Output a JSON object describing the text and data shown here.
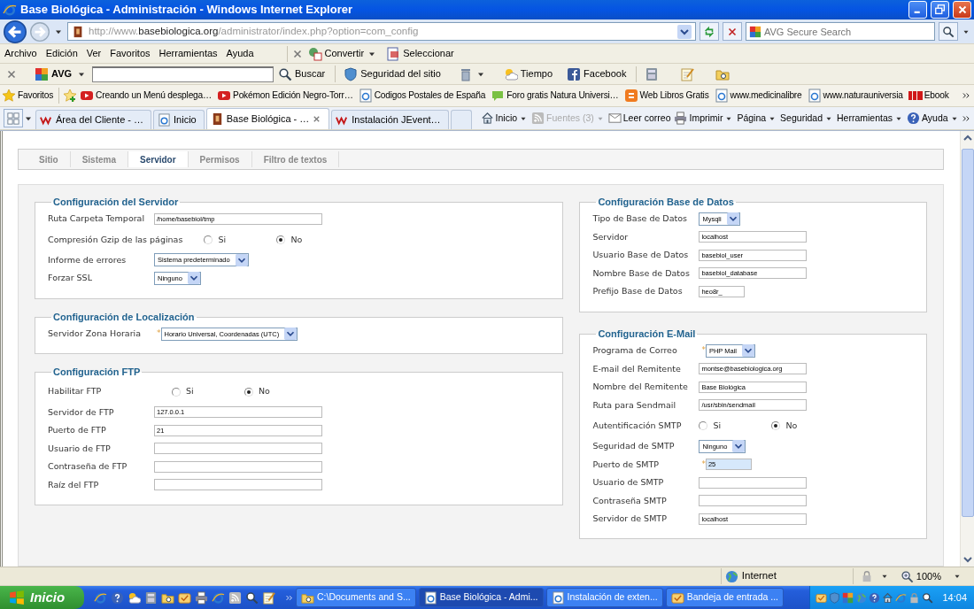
{
  "window": {
    "title": "Base Biológica - Administración - Windows Internet Explorer"
  },
  "address_bar": {
    "url_prefix": "http://www.",
    "url_domain": "basebiologica.org",
    "url_path": "/administrator/index.php?option=com_config"
  },
  "search": {
    "placeholder": "AVG Secure Search"
  },
  "menu": [
    "Archivo",
    "Edición",
    "Ver",
    "Favoritos",
    "Herramientas",
    "Ayuda"
  ],
  "menu_tools": [
    {
      "label": "Convertir",
      "kind": "convert",
      "dropdown": true
    },
    {
      "label": "Seleccionar",
      "kind": "select",
      "dropdown": false
    }
  ],
  "avg_toolbar": {
    "brand": "AVG",
    "items": [
      {
        "label": "Buscar",
        "kind": "search",
        "dropdown": false,
        "separator_before": false
      },
      {
        "label": "Seguridad del sitio",
        "kind": "shield",
        "dropdown": false,
        "separator_before": true
      },
      {
        "kind": "trash",
        "dropdown": true,
        "separator_before": false
      },
      {
        "label": "Tiempo",
        "kind": "weather",
        "dropdown": false,
        "separator_before": false
      },
      {
        "label": "Facebook",
        "kind": "facebook",
        "dropdown": false,
        "separator_before": false
      },
      {
        "kind": "calculator",
        "dropdown": false,
        "separator_before": true
      },
      {
        "kind": "notepad",
        "dropdown": false,
        "separator_before": false
      },
      {
        "kind": "folder",
        "dropdown": false,
        "separator_before": false
      }
    ]
  },
  "favorites": {
    "label": "Favoritos",
    "links": [
      {
        "label": "Creando un Menú desplega…",
        "kind": "video"
      },
      {
        "label": "Pokémon Edición Negro-Torr…",
        "kind": "video"
      },
      {
        "label": "Codigos Postales de España",
        "kind": "page"
      },
      {
        "label": "Foro gratis  Natura Universi…",
        "kind": "chat"
      },
      {
        "label": "Web Libros Gratis",
        "kind": "blog"
      },
      {
        "label": "www.medicinalibre",
        "kind": "page"
      },
      {
        "label": "www.naturauniversia",
        "kind": "page"
      },
      {
        "label": "Ebook",
        "kind": "jam"
      }
    ]
  },
  "browser_tabs": [
    {
      "label": "Área del Cliente - …",
      "kind": "w",
      "selected": false
    },
    {
      "label": "Inicio",
      "kind": "page",
      "selected": false
    },
    {
      "label": "Base Biológica - …",
      "kind": "site",
      "selected": true
    },
    {
      "label": "Instalación JEvent…",
      "kind": "w",
      "selected": false
    }
  ],
  "command_bar": [
    {
      "label": "Inicio",
      "kind": "home",
      "dropdown": true,
      "disabled": false
    },
    {
      "label": "Fuentes (3)",
      "kind": "feed",
      "dropdown": true,
      "disabled": true
    },
    {
      "label": "Leer correo",
      "kind": "mail",
      "dropdown": false,
      "disabled": false
    },
    {
      "label": "Imprimir",
      "kind": "print",
      "dropdown": true,
      "disabled": false
    },
    {
      "label": "Página",
      "kind": "none",
      "dropdown": true,
      "disabled": false
    },
    {
      "label": "Seguridad",
      "kind": "none",
      "dropdown": true,
      "disabled": false
    },
    {
      "label": "Herramientas",
      "kind": "none",
      "dropdown": true,
      "disabled": false
    },
    {
      "label": "Ayuda",
      "kind": "help",
      "dropdown": true,
      "disabled": false
    }
  ],
  "config_tabs": [
    {
      "label": "Sitio",
      "selected": false
    },
    {
      "label": "Sistema",
      "selected": false
    },
    {
      "label": "Servidor",
      "selected": true
    },
    {
      "label": "Permisos",
      "selected": false
    },
    {
      "label": "Filtro de textos",
      "selected": false
    }
  ],
  "left_column": [
    {
      "legend": "Configuración del Servidor",
      "fields": [
        {
          "label": "Ruta Carpeta Temporal",
          "kind": "text",
          "value": "/home/basebiol/tmp",
          "highlighted": false
        },
        {
          "label": "Compresión Gzip de las páginas",
          "kind": "radio",
          "options": [
            {
              "label": "Si",
              "selected": false
            },
            {
              "label": "No",
              "selected": true
            }
          ]
        },
        {
          "label": "Informe de errores",
          "kind": "select",
          "value": "Sistema predeterminado"
        },
        {
          "label": "Forzar SSL",
          "kind": "select",
          "value": "Ninguno"
        }
      ]
    },
    {
      "legend": "Configuración de Localización",
      "fields": [
        {
          "label": "Servidor Zona Horaria",
          "required_mark": "*",
          "kind": "select",
          "value": "Horario Universal, Coordenadas (UTC)"
        }
      ]
    },
    {
      "legend": "Configuración FTP",
      "fields": [
        {
          "label": "Habilitar FTP",
          "kind": "radio",
          "options": [
            {
              "label": "Si",
              "selected": false
            },
            {
              "label": "No",
              "selected": true
            }
          ]
        },
        {
          "label": "Servidor de FTP",
          "kind": "text",
          "value": "127.0.0.1",
          "highlighted": false
        },
        {
          "label": "Puerto de FTP",
          "kind": "text",
          "value": "21",
          "highlighted": false
        },
        {
          "label": "Usuario de FTP",
          "kind": "text",
          "highlighted": false
        },
        {
          "label": "Contraseña de FTP",
          "kind": "text",
          "highlighted": false
        },
        {
          "label": "Raíz del FTP",
          "kind": "text",
          "highlighted": false
        }
      ]
    }
  ],
  "right_column": [
    {
      "legend": "Configuración Base de Datos",
      "fields": [
        {
          "label": "Tipo de Base de Datos",
          "kind": "select",
          "value": "Mysqli"
        },
        {
          "label": "Servidor",
          "kind": "text",
          "value": "localhost",
          "highlighted": false
        },
        {
          "label": "Usuario Base de Datos",
          "kind": "text",
          "value": "basebiol_user",
          "highlighted": false
        },
        {
          "label": "Nombre Base de Datos",
          "kind": "text",
          "value": "basebiol_database",
          "highlighted": false
        },
        {
          "label": "Prefijo Base de Datos",
          "kind": "text",
          "value": "heo8r_",
          "highlighted": false
        }
      ]
    },
    {
      "legend": "Configuración E-Mail",
      "fields": [
        {
          "label": "Programa de Correo",
          "required_mark": "*",
          "kind": "select",
          "value": "PHP Mail"
        },
        {
          "label": "E-mail del Remitente",
          "kind": "text",
          "value": "montse@basebiologica.org",
          "highlighted": false
        },
        {
          "label": "Nombre del Remitente",
          "kind": "text",
          "value": "Base Biológica",
          "highlighted": false
        },
        {
          "label": "Ruta para Sendmail",
          "kind": "text",
          "value": "/usr/sbin/sendmail",
          "highlighted": false
        },
        {
          "label": "Autentificación SMTP",
          "kind": "radio",
          "options": [
            {
              "label": "Si",
              "selected": false
            },
            {
              "label": "No",
              "selected": true
            }
          ]
        },
        {
          "label": "Seguridad de SMTP",
          "kind": "select",
          "value": "Ninguno"
        },
        {
          "label": "Puerto de SMTP",
          "required_mark": "*",
          "kind": "text",
          "value": "25",
          "highlighted": true
        },
        {
          "label": "Usuario de SMTP",
          "kind": "text",
          "highlighted": false
        },
        {
          "label": "Contraseña SMTP",
          "kind": "text",
          "highlighted": false
        },
        {
          "label": "Servidor de SMTP",
          "kind": "text",
          "value": "localhost",
          "highlighted": false
        }
      ]
    }
  ],
  "status_bar": {
    "zone": "Internet",
    "zoom": "100%"
  },
  "taskbar": {
    "start": "Inicio",
    "tasks": [
      {
        "label": "C:\\Documents and S...",
        "kind": "folder",
        "selected": false
      },
      {
        "label": "Base Biológica - Admi...",
        "kind": "page",
        "selected": true
      },
      {
        "label": "Instalación de exten...",
        "kind": "page",
        "selected": false
      },
      {
        "label": "Bandeja de entrada ...",
        "kind": "mailbox",
        "selected": false
      }
    ],
    "clock": "14:04"
  }
}
